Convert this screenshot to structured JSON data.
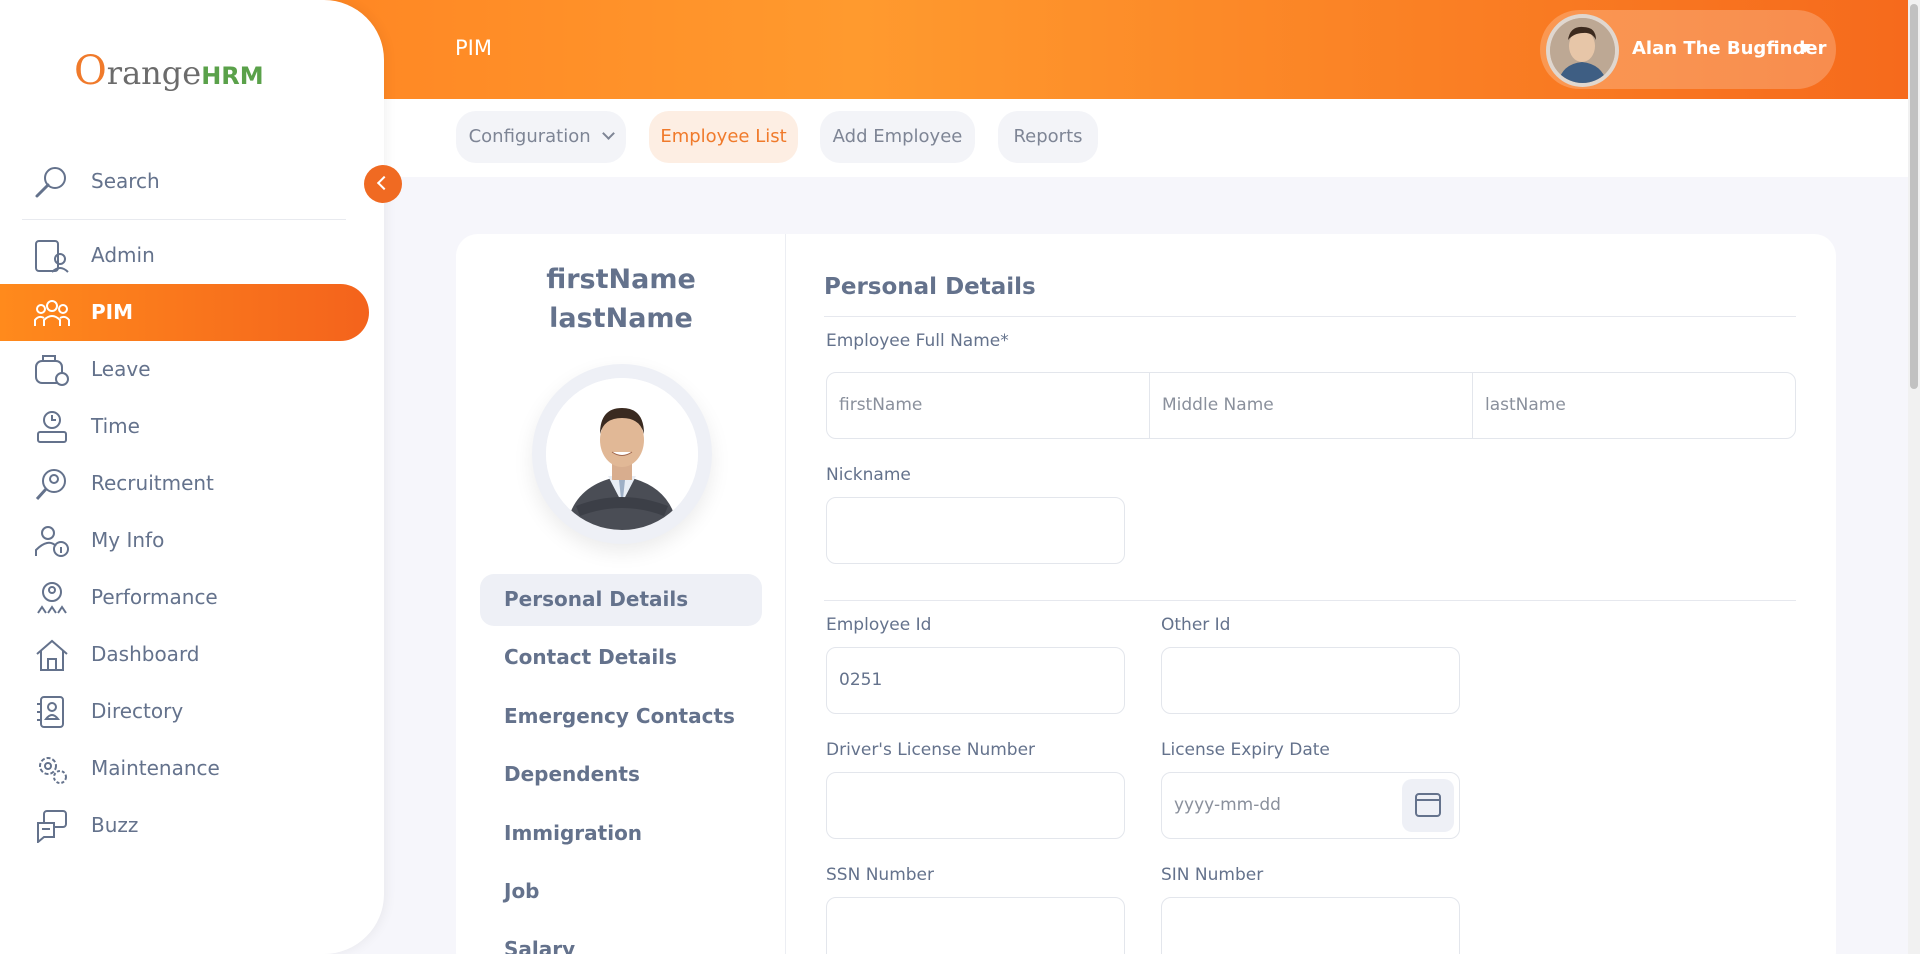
{
  "header": {
    "title": "PIM",
    "user_name": "Alan The Bugfinder"
  },
  "subnav": {
    "tabs": [
      {
        "label": "Configuration"
      },
      {
        "label": "Employee List"
      },
      {
        "label": "Add Employee"
      },
      {
        "label": "Reports"
      }
    ]
  },
  "sidebar": {
    "logo": {
      "o": "O",
      "range": "range",
      "hrm": "HRM"
    },
    "search_label": "Search",
    "items": [
      {
        "label": "Admin",
        "icon": "admin-icon"
      },
      {
        "label": "PIM",
        "icon": "pim-icon"
      },
      {
        "label": "Leave",
        "icon": "leave-icon"
      },
      {
        "label": "Time",
        "icon": "time-icon"
      },
      {
        "label": "Recruitment",
        "icon": "recruitment-icon"
      },
      {
        "label": "My Info",
        "icon": "my-info-icon"
      },
      {
        "label": "Performance",
        "icon": "performance-icon"
      },
      {
        "label": "Dashboard",
        "icon": "dashboard-icon"
      },
      {
        "label": "Directory",
        "icon": "directory-icon"
      },
      {
        "label": "Maintenance",
        "icon": "maintenance-icon"
      },
      {
        "label": "Buzz",
        "icon": "buzz-icon"
      }
    ]
  },
  "profile": {
    "first_name": "firstName",
    "last_name": "lastName",
    "tabs": [
      {
        "label": "Personal Details"
      },
      {
        "label": "Contact Details"
      },
      {
        "label": "Emergency Contacts"
      },
      {
        "label": "Dependents"
      },
      {
        "label": "Immigration"
      },
      {
        "label": "Job"
      },
      {
        "label": "Salary"
      }
    ]
  },
  "form": {
    "section_title": "Personal Details",
    "full_name_label": "Employee Full Name*",
    "first_name_placeholder": "firstName",
    "middle_name_placeholder": "Middle Name",
    "last_name_placeholder": "lastName",
    "nickname_label": "Nickname",
    "employee_id_label": "Employee Id",
    "employee_id_value": "0251",
    "other_id_label": "Other Id",
    "license_label": "Driver's License Number",
    "license_expiry_label": "License Expiry Date",
    "license_expiry_placeholder": "yyyy-mm-dd",
    "ssn_label": "SSN Number",
    "sin_label": "SIN Number"
  },
  "colors": {
    "accent": "#ff7b1d",
    "text": "#64728c"
  }
}
